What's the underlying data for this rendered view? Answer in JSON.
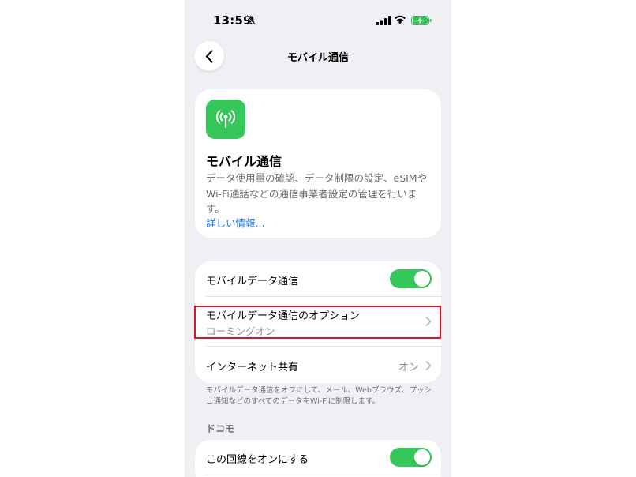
{
  "status_bar": {
    "time": "13:59",
    "icons": [
      "bell-slash-icon",
      "cellular-signal-icon",
      "wifi-icon",
      "battery-charging-icon"
    ]
  },
  "nav": {
    "back_icon": "chevron-left-icon",
    "title": "モバイル通信"
  },
  "hero": {
    "icon": "antenna-icon",
    "icon_color": "#35c759",
    "title": "モバイル通信",
    "description": "データ使用量の確認、データ制限の設定、eSIMやWi-Fi通話などの通信事業者設定の管理を行います。",
    "more_link": "詳しい情報..."
  },
  "settings": {
    "mobile_data": {
      "label": "モバイルデータ通信",
      "on": true
    },
    "mobile_data_options": {
      "label": "モバイルデータ通信のオプション",
      "sublabel": "ローミングオン"
    },
    "personal_hotspot": {
      "label": "インターネット共有",
      "value": "オン"
    }
  },
  "footnote": "モバイルデータ通信をオフにして、メール、Webブラウズ、プッシュ通知などのすべてのデータをWi-Fiに制限します。",
  "carrier_section": {
    "header": "ドコモ",
    "line_toggle": {
      "label": "この回線をオンにする",
      "on": true
    }
  },
  "accent_color": "#35c759",
  "link_color": "#1a73e8",
  "highlight_color": "#e3121c"
}
